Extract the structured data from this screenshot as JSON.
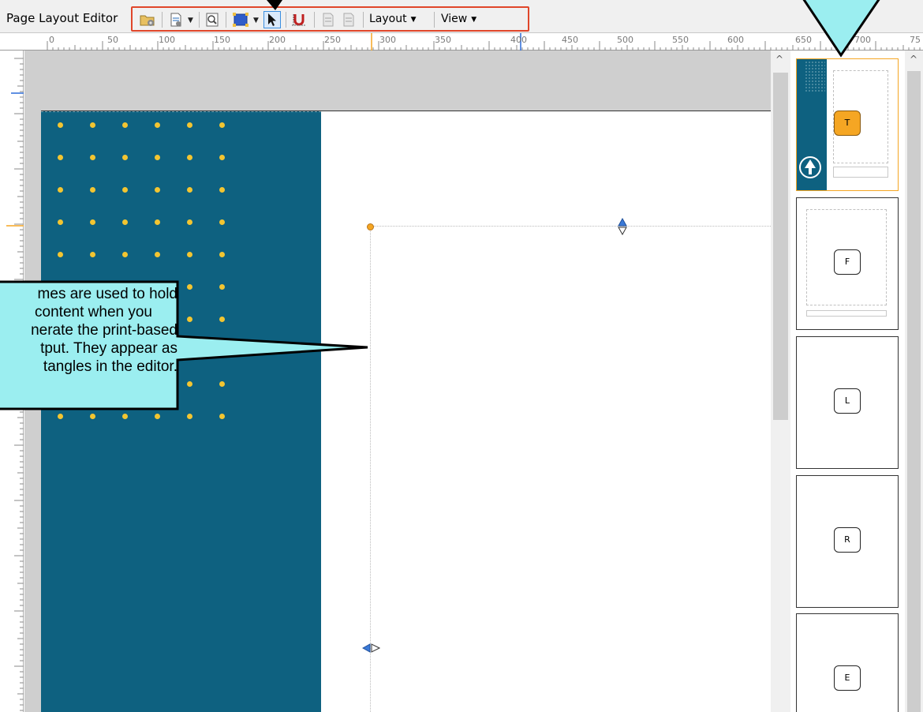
{
  "editor": {
    "title": "Page Layout Editor",
    "menus": {
      "layout": "Layout",
      "view": "View"
    }
  },
  "toolbar_icons": [
    "open-folder-icon",
    "page-template-icon",
    "preview-icon",
    "frame-tool-icon",
    "pointer-icon",
    "magnet-snap-icon",
    "bring-forward-icon",
    "send-backward-icon"
  ],
  "ruler": {
    "labels": [
      "0",
      "50",
      "100",
      "150",
      "200",
      "250",
      "300",
      "350",
      "400",
      "450",
      "500",
      "550",
      "600",
      "650",
      "700",
      "75"
    ]
  },
  "callout": {
    "lines": [
      "mes are used to hold",
      "content when you",
      "nerate the print-based",
      "tput. They appear as",
      "tangles in the editor."
    ]
  },
  "thumbnails": [
    {
      "badge": "T",
      "selected": true
    },
    {
      "badge": "F",
      "selected": false
    },
    {
      "badge": "L",
      "selected": false
    },
    {
      "badge": "R",
      "selected": false
    },
    {
      "badge": "E",
      "selected": false
    }
  ],
  "colors": {
    "cover_background": "#0e6180",
    "cover_dots": "#f2c531",
    "selection_accent": "#f5a623",
    "toolbar_highlight": "#e0462a",
    "callout_fill": "#9beef0"
  }
}
